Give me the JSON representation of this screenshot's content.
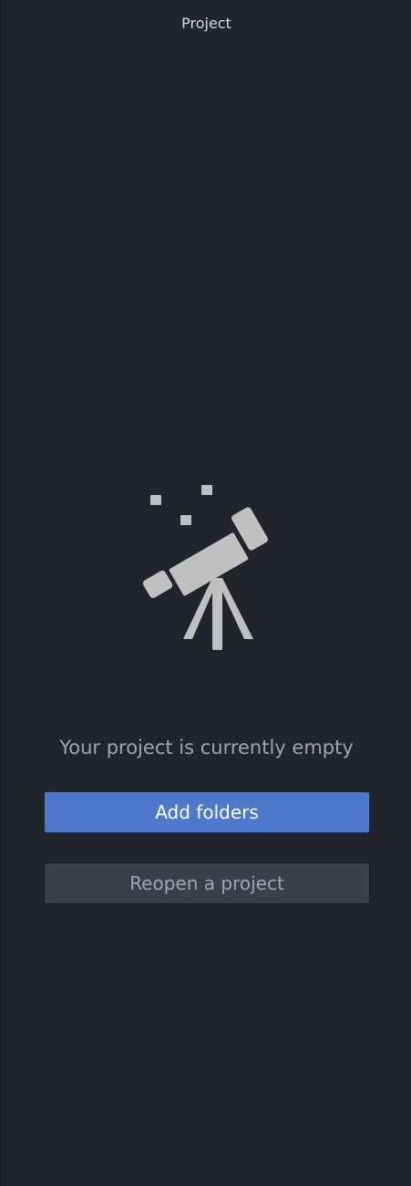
{
  "panel": {
    "title": "Project"
  },
  "empty_state": {
    "icon": "telescope-icon",
    "message": "Your project is currently empty",
    "add_folders_label": "Add folders",
    "reopen_project_label": "Reopen a project"
  },
  "colors": {
    "background": "#21252b",
    "primary_button": "#4d78cc",
    "secondary_button": "#3a3f4b",
    "muted_text": "#9da5b4",
    "icon": "#c0c0c0"
  }
}
